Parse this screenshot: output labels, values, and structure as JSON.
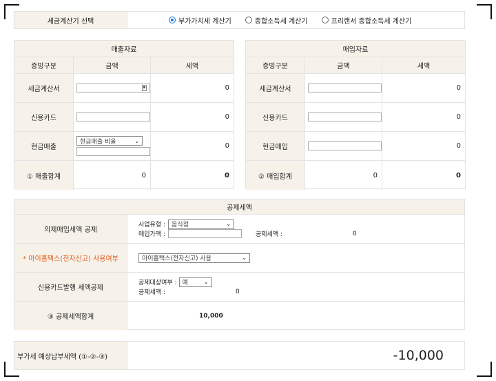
{
  "selector": {
    "label": "세금계산기 선택",
    "options": [
      "부가가치세 계산기",
      "종합소득세 계산기",
      "프리랜서 종합소득세 계산기"
    ],
    "selected_index": 0
  },
  "sales": {
    "title": "매출자료",
    "headers": [
      "증빙구분",
      "금액",
      "세액"
    ],
    "rows": [
      {
        "label": "세금계산서",
        "tax": "0"
      },
      {
        "label": "신용카드",
        "tax": "0"
      },
      {
        "label": "현금매출",
        "select": "현금매출 비율",
        "tax": "0"
      },
      {
        "label": "① 매출합계",
        "amount": "0",
        "tax": "0"
      }
    ]
  },
  "purchase": {
    "title": "매입자료",
    "headers": [
      "증빙구분",
      "금액",
      "세액"
    ],
    "rows": [
      {
        "label": "세금계산서",
        "tax": "0"
      },
      {
        "label": "신용카드",
        "tax": "0"
      },
      {
        "label": "현금매입",
        "tax": "0"
      },
      {
        "label": "② 매입합계",
        "amount": "0",
        "tax": "0"
      }
    ]
  },
  "deductions": {
    "title": "공제세액",
    "deemed": {
      "label": "의제매입세액 공제",
      "biz_type_label": "사업유형 :",
      "biz_type_value": "음식점",
      "purchase_label": "매입가액 :",
      "deduct_label": "공제세액 :",
      "deduct_value": "0"
    },
    "hometax": {
      "label": "* 아이홈택스(전자신고) 사용여부",
      "value": "아이홈택스(전자신고) 사용"
    },
    "card": {
      "label": "신용카드발행 세액공제",
      "target_label": "공제대상여부 :",
      "target_value": "예",
      "deduct_label": "공제세액 :",
      "deduct_value": "0"
    },
    "total": {
      "label": "③ 공제세액합계",
      "value": "10,000"
    }
  },
  "result": {
    "label": "부가세 예상납부세액 (①-②-③)",
    "value": "-10,000"
  }
}
